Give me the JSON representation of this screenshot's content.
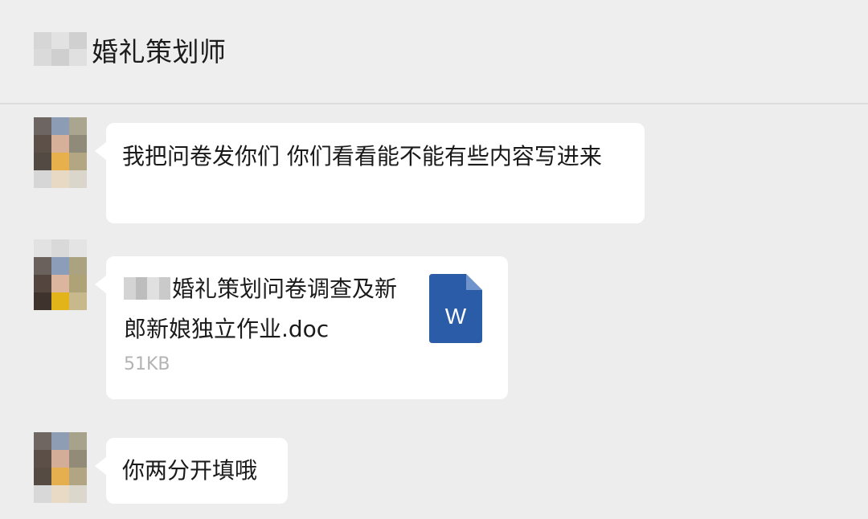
{
  "header": {
    "title": "婚礼策划师"
  },
  "messages": [
    {
      "type": "text",
      "text": "我把问卷发你们 你们看看能不能有些内容写进来"
    },
    {
      "type": "file",
      "file_name": "婚礼策划问卷调查及新郎新娘独立作业.doc",
      "file_size": "51KB",
      "icon": "word-document-icon",
      "icon_letter": "W"
    },
    {
      "type": "text",
      "text": "你两分开填哦"
    }
  ],
  "colors": {
    "background": "#ededee",
    "bubble": "#ffffff",
    "word_blue": "#2b5ca8"
  }
}
